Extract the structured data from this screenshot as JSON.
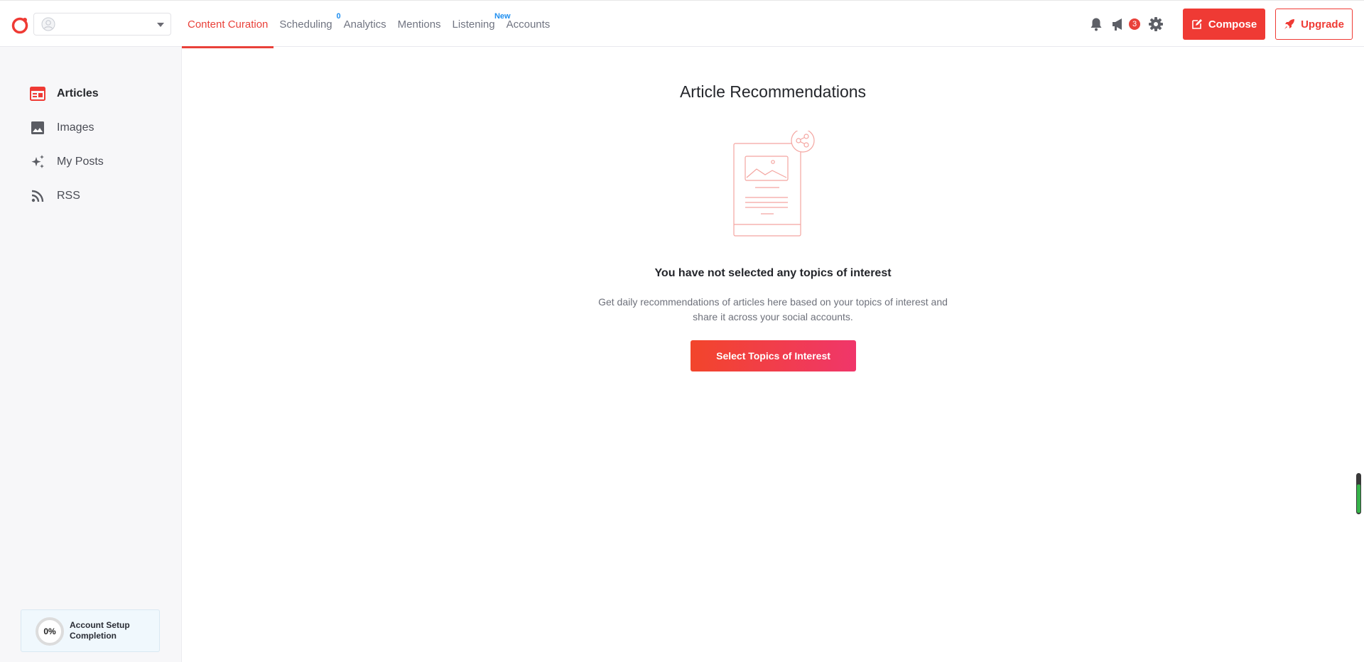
{
  "topbar": {
    "workspace_name": "",
    "nav": [
      {
        "label": "Content Curation",
        "active": true,
        "sup": ""
      },
      {
        "label": "Scheduling",
        "active": false,
        "sup": "0"
      },
      {
        "label": "Analytics",
        "active": false,
        "sup": ""
      },
      {
        "label": "Mentions",
        "active": false,
        "sup": ""
      },
      {
        "label": "Listening",
        "active": false,
        "sup": "New"
      },
      {
        "label": "Accounts",
        "active": false,
        "sup": ""
      }
    ],
    "announcements_count": "3",
    "compose_label": "Compose",
    "upgrade_label": "Upgrade",
    "icons": [
      "bell-icon",
      "megaphone-icon",
      "gear-icon",
      "compose-icon",
      "rocket-icon"
    ]
  },
  "sidebar": {
    "items": [
      {
        "label": "Articles",
        "icon": "articles-icon",
        "active": true
      },
      {
        "label": "Images",
        "icon": "image-icon",
        "active": false
      },
      {
        "label": "My Posts",
        "icon": "sparkle-icon",
        "active": false
      },
      {
        "label": "RSS",
        "icon": "rss-icon",
        "active": false
      }
    ],
    "setup": {
      "percent": "0%",
      "label_line1": "Account Setup",
      "label_line2": "Completion"
    }
  },
  "main": {
    "title": "Article Recommendations",
    "empty_title": "You have not selected any topics of interest",
    "empty_description": "Get daily recommendations of articles here based on your topics of interest and share it across your social accounts.",
    "cta_label": "Select Topics of Interest"
  },
  "colors": {
    "accent": "#ef3a34",
    "nav_sup": "#1f8ff0",
    "sidebar_bg": "#f7f7f9",
    "setup_bg": "#f0f8fd"
  },
  "scroll_indicator_fill": 0.75
}
